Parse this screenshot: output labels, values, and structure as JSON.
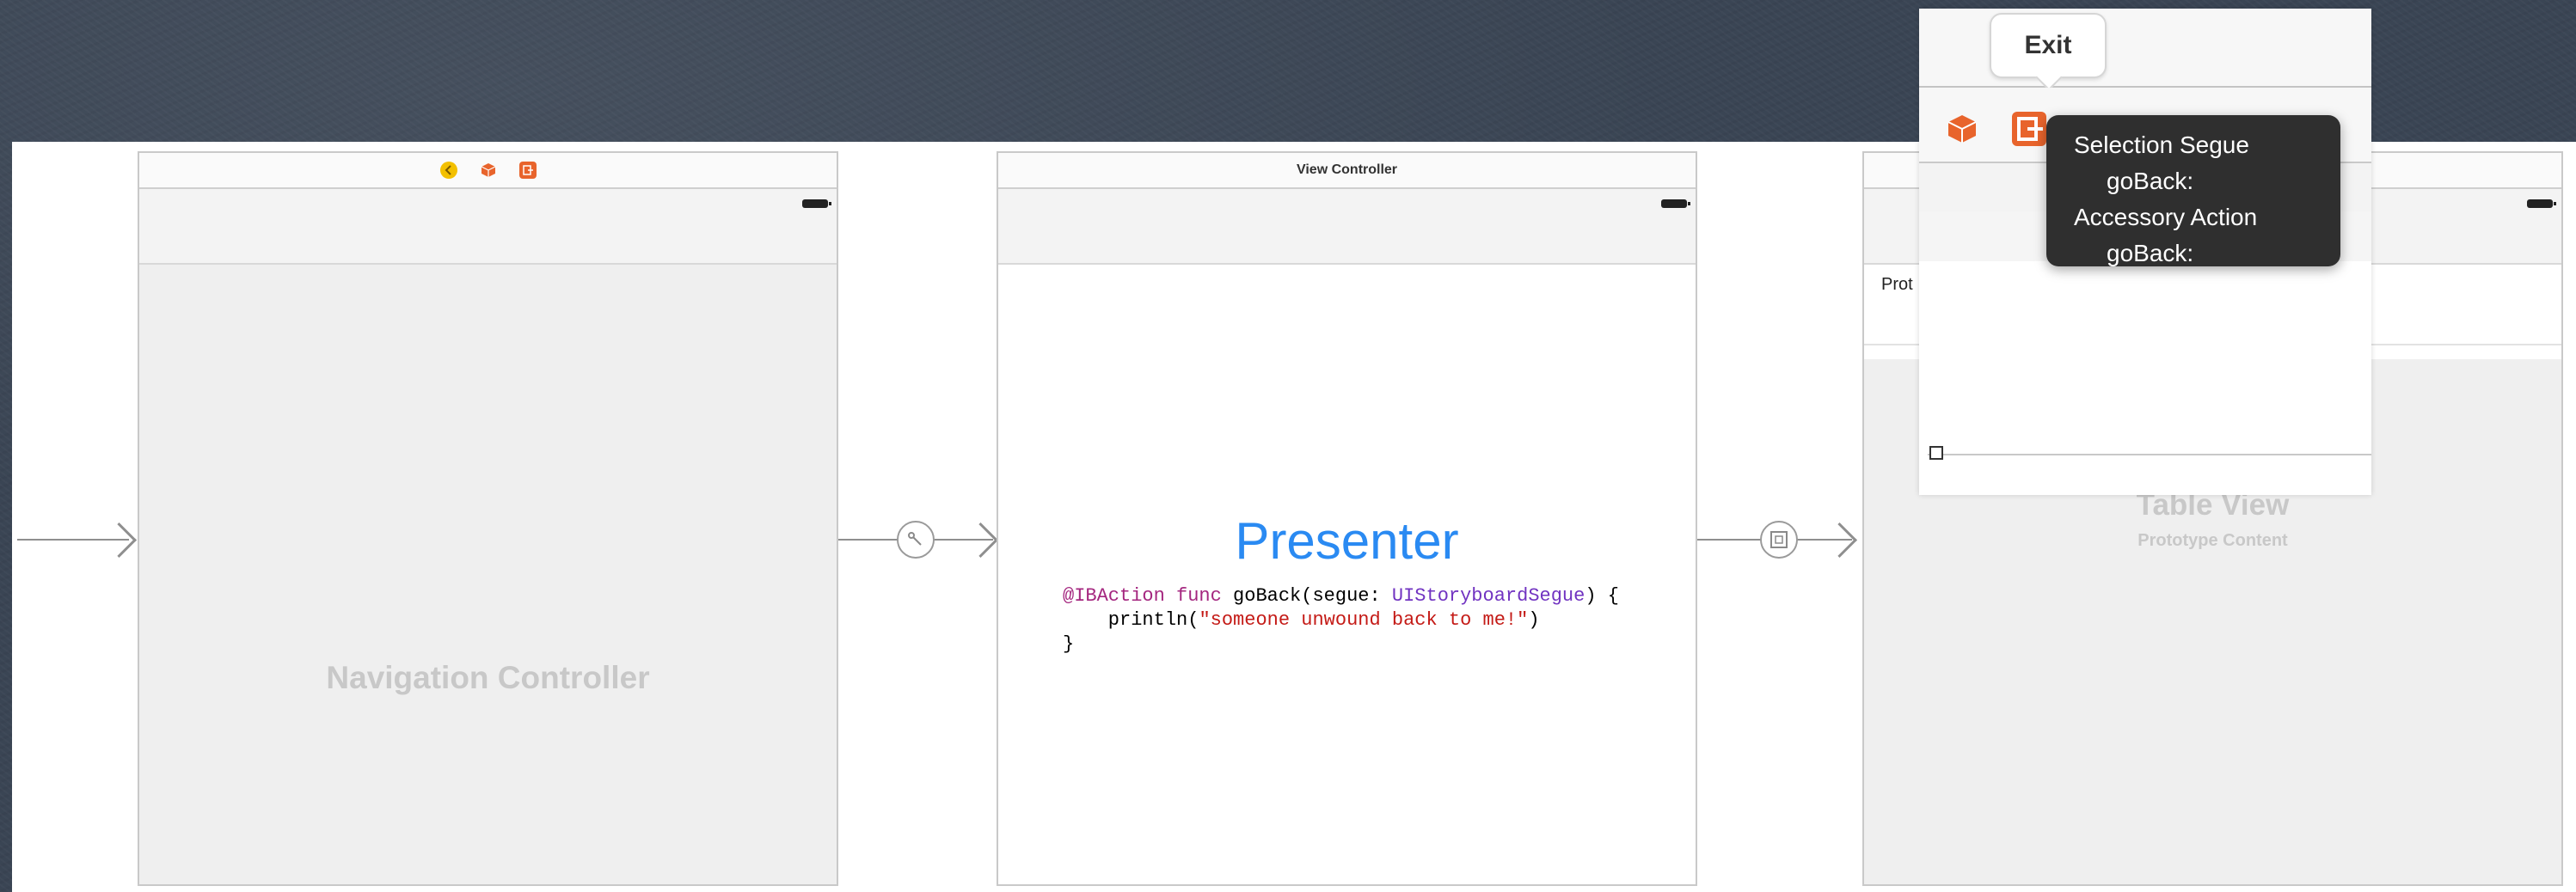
{
  "scenes": {
    "navigation": {
      "label": "Navigation Controller"
    },
    "presenter": {
      "bar_title": "View Controller",
      "label": "Presenter",
      "code_line1_kw1": "@IBAction",
      "code_line1_kw2": "func",
      "code_line1_name": "goBack(segue:",
      "code_line1_type": "UIStoryboardSegue",
      "code_line1_end": ") {",
      "code_line2_fn": "    println(",
      "code_line2_str": "\"someone unwound back to me!\"",
      "code_line2_end": ")",
      "code_line3": "}"
    },
    "table": {
      "label": "Table View",
      "sublabel": "Prototype Content",
      "prototype_prefix": "Prot"
    }
  },
  "zoom_panel": {
    "exit_label": "Exit",
    "menu": [
      {
        "label": "Selection Segue",
        "kind": "head"
      },
      {
        "label": "goBack:",
        "kind": "sub"
      },
      {
        "label": "Accessory Action",
        "kind": "head"
      },
      {
        "label": "goBack:",
        "kind": "sub"
      }
    ]
  },
  "icons": {
    "back": "back-icon",
    "cube": "cube-icon",
    "exit": "exit-icon",
    "segue_push": "push-segue-icon",
    "segue_relationship": "relationship-segue-icon"
  },
  "colors": {
    "accent_blue": "#2a8af2",
    "exit_orange": "#e8642c",
    "back_yellow": "#f3c000"
  }
}
